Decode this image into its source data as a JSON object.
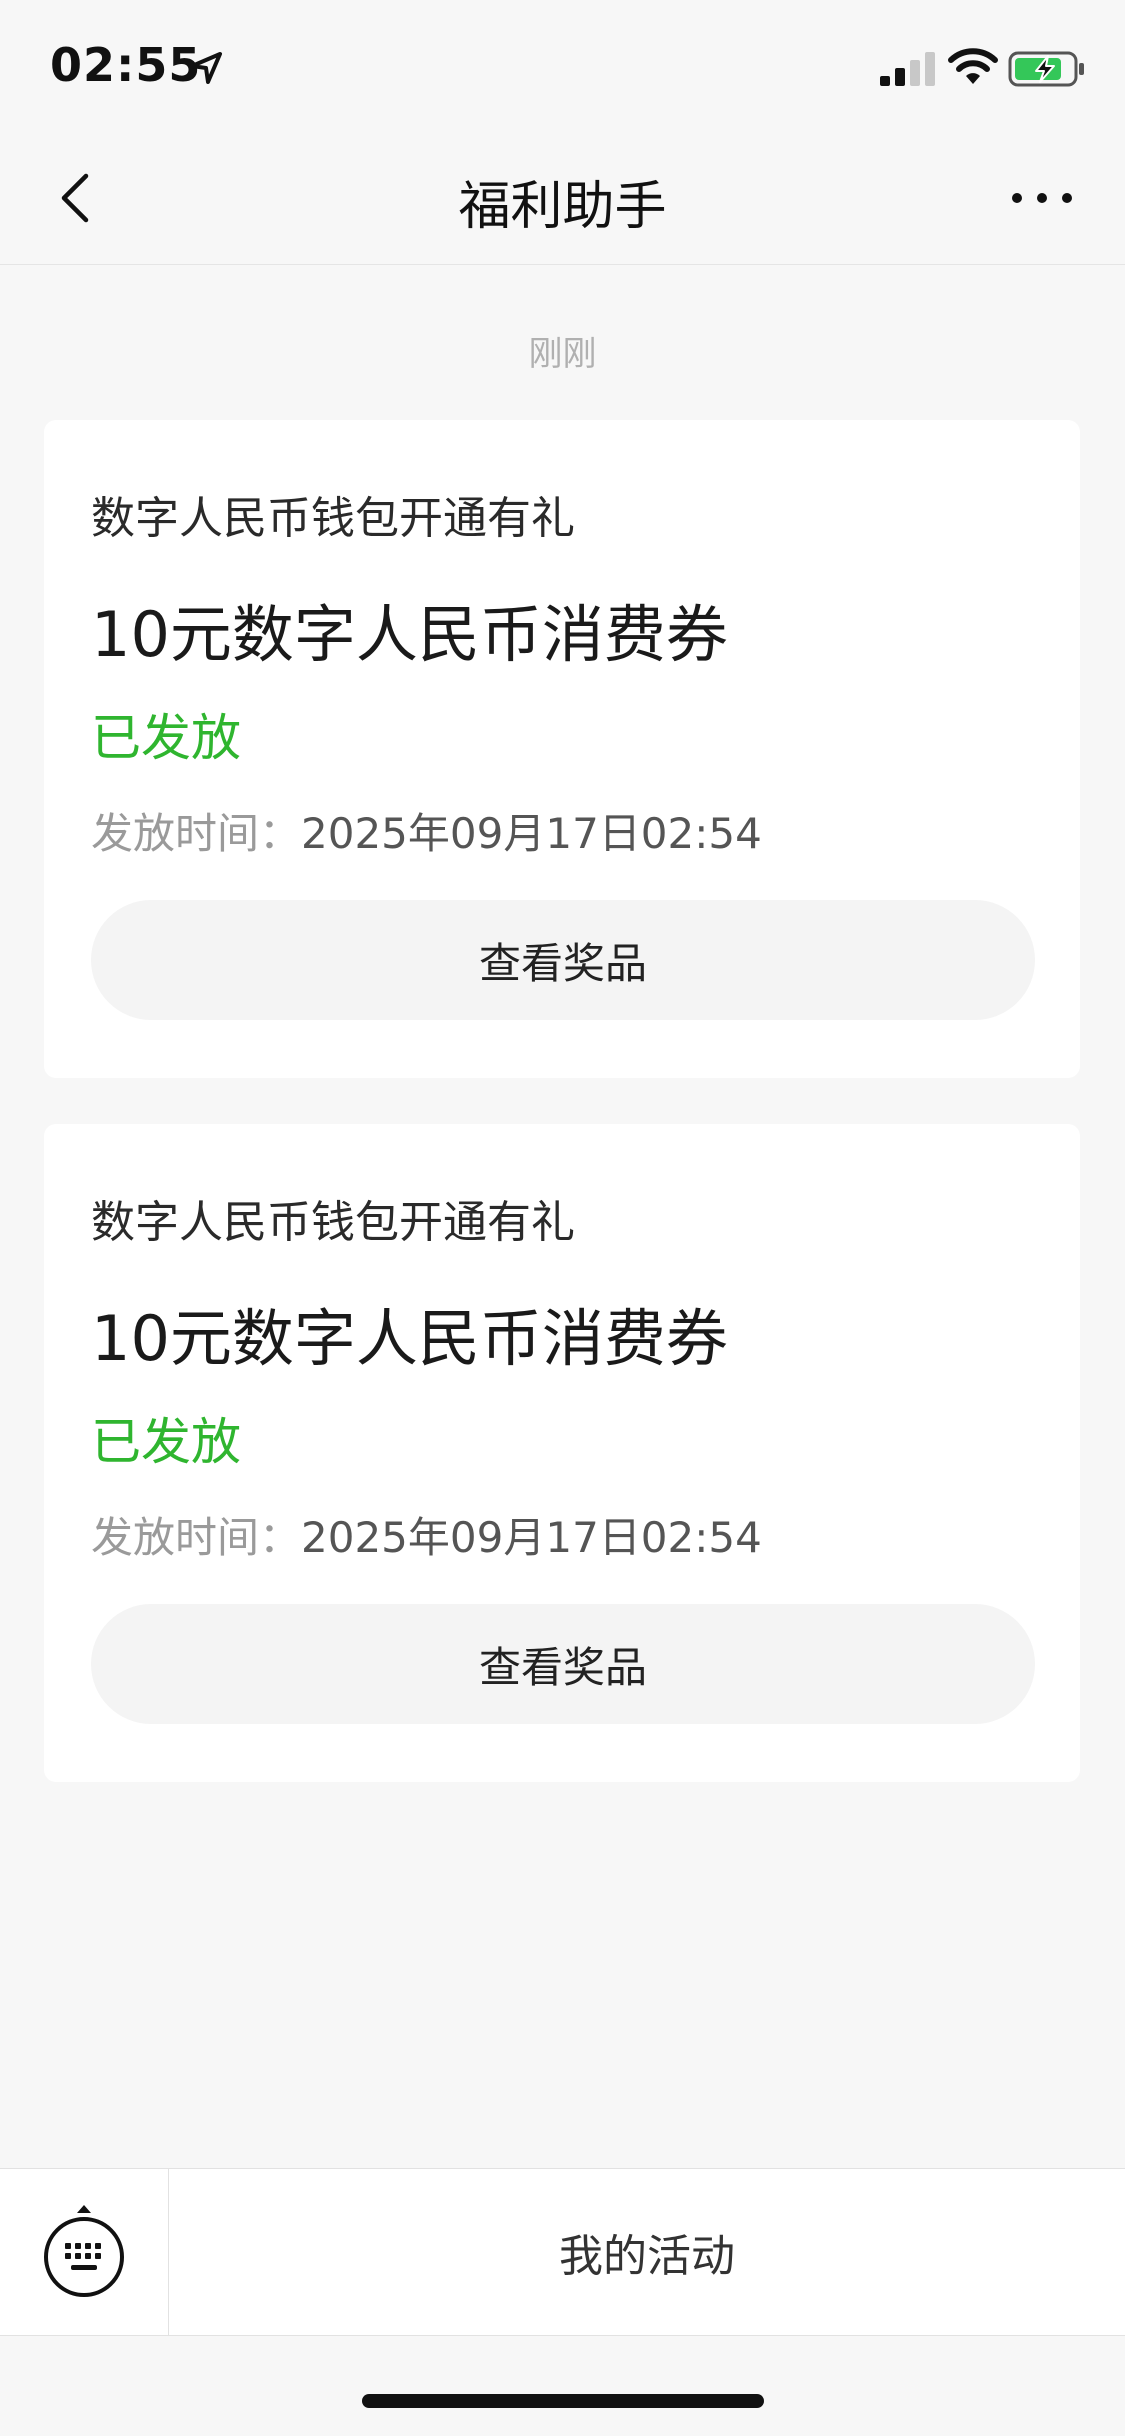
{
  "status_bar": {
    "time": "02:55",
    "icons": [
      "location-arrow-icon",
      "cellular-signal-icon",
      "wifi-icon",
      "battery-charging-icon"
    ],
    "battery_color": "#34c759"
  },
  "nav": {
    "title": "福利助手",
    "back_icon": "chevron-left-icon",
    "more_icon": "more-dots-icon"
  },
  "time_label": "刚刚",
  "cards": [
    {
      "subtitle": "数字人民币钱包开通有礼",
      "title": "10元数字人民币消费券",
      "status": "已发放",
      "time_label": "发放时间：",
      "time_value": "2025年09月17日02:54",
      "button_label": "查看奖品"
    },
    {
      "subtitle": "数字人民币钱包开通有礼",
      "title": "10元数字人民币消费券",
      "status": "已发放",
      "time_label": "发放时间：",
      "time_value": "2025年09月17日02:54",
      "button_label": "查看奖品"
    }
  ],
  "colors": {
    "status_green": "#2fb52f",
    "background": "#f7f7f7",
    "card": "#ffffff"
  },
  "bottom_bar": {
    "keyboard_icon": "keyboard-icon",
    "menu_label": "我的活动"
  }
}
